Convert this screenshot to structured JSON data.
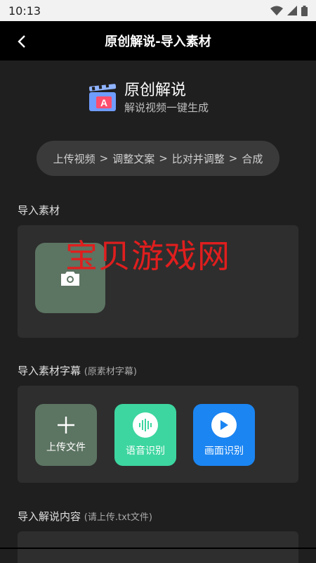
{
  "status_bar": {
    "time": "10:13"
  },
  "header": {
    "title": "原创解说-导入素材"
  },
  "hero": {
    "title": "原创解说",
    "subtitle": "解说视频一键生成",
    "logo_letter": "A"
  },
  "steps": [
    "上传视频",
    "调整文案",
    "比对并调整",
    "合成"
  ],
  "step_separator": ">",
  "sections": {
    "import_material": {
      "title": "导入素材"
    },
    "import_subtitles": {
      "title": "导入素材字幕",
      "hint": "(原素材字幕)"
    },
    "import_narration": {
      "title": "导入解说内容",
      "hint": "(请上传.txt文件)"
    }
  },
  "subtitle_buttons": {
    "upload": "上传文件",
    "voice": "语音识别",
    "frame": "画面识别"
  },
  "watermark": "宝贝游戏网",
  "colors": {
    "accent_green": "#3dd6a0",
    "accent_blue": "#1b85f2",
    "tile_gray_green": "#5c7462",
    "watermark_red": "#e01e1e"
  },
  "icons": {
    "back": "chevron-left-icon",
    "camera": "camera-icon",
    "plus": "plus-icon",
    "voice": "sound-wave-icon",
    "play": "play-icon"
  }
}
